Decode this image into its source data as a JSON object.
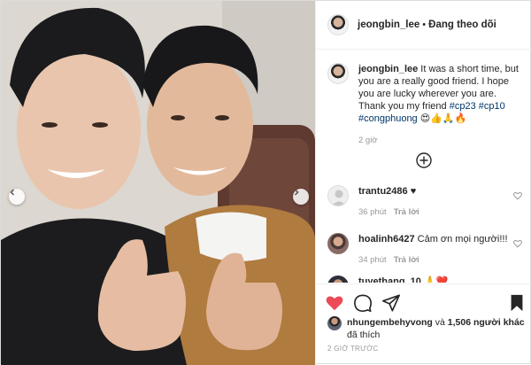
{
  "post": {
    "username": "jeongbin_lee",
    "follow_separator": "•",
    "follow_label": "Đang theo dõi",
    "caption": {
      "username": "jeongbin_lee",
      "text": " It was a short time, but you are a really good friend. I hope you are lucky wherever you are. Thank you my friend ",
      "tags": [
        "#cp23",
        "#cp10",
        "#congphuong"
      ],
      "emojis": "😍👍🙏🔥",
      "time": "2 giờ"
    },
    "comments": [
      {
        "username": "trantu2486",
        "text": " ♥",
        "time": "36 phút",
        "reply": "Trả lời"
      },
      {
        "username": "hoalinh6427",
        "text": " Cảm ơn mọi người!!!",
        "time": "34 phút",
        "reply": "Trả lời"
      },
      {
        "username": "tuyethang_10",
        "text": " 🙏❤️",
        "time": "",
        "reply": ""
      }
    ],
    "likes": {
      "liker": "nhungembehyvong",
      "connector": " và ",
      "others": "1,506 người khác",
      "suffix": " đã thích"
    },
    "time_ago": "2 GIỜ TRƯỚC"
  },
  "icons": {
    "like": "heart-filled-icon",
    "comment": "speech-bubble-icon",
    "share": "paper-plane-icon",
    "save": "bookmark-icon",
    "load_more": "plus-circle-icon",
    "prev": "chevron-left-icon",
    "next": "chevron-right-icon"
  },
  "colors": {
    "like_red": "#ed4956",
    "hashtag": "#003569",
    "muted": "#999999"
  }
}
